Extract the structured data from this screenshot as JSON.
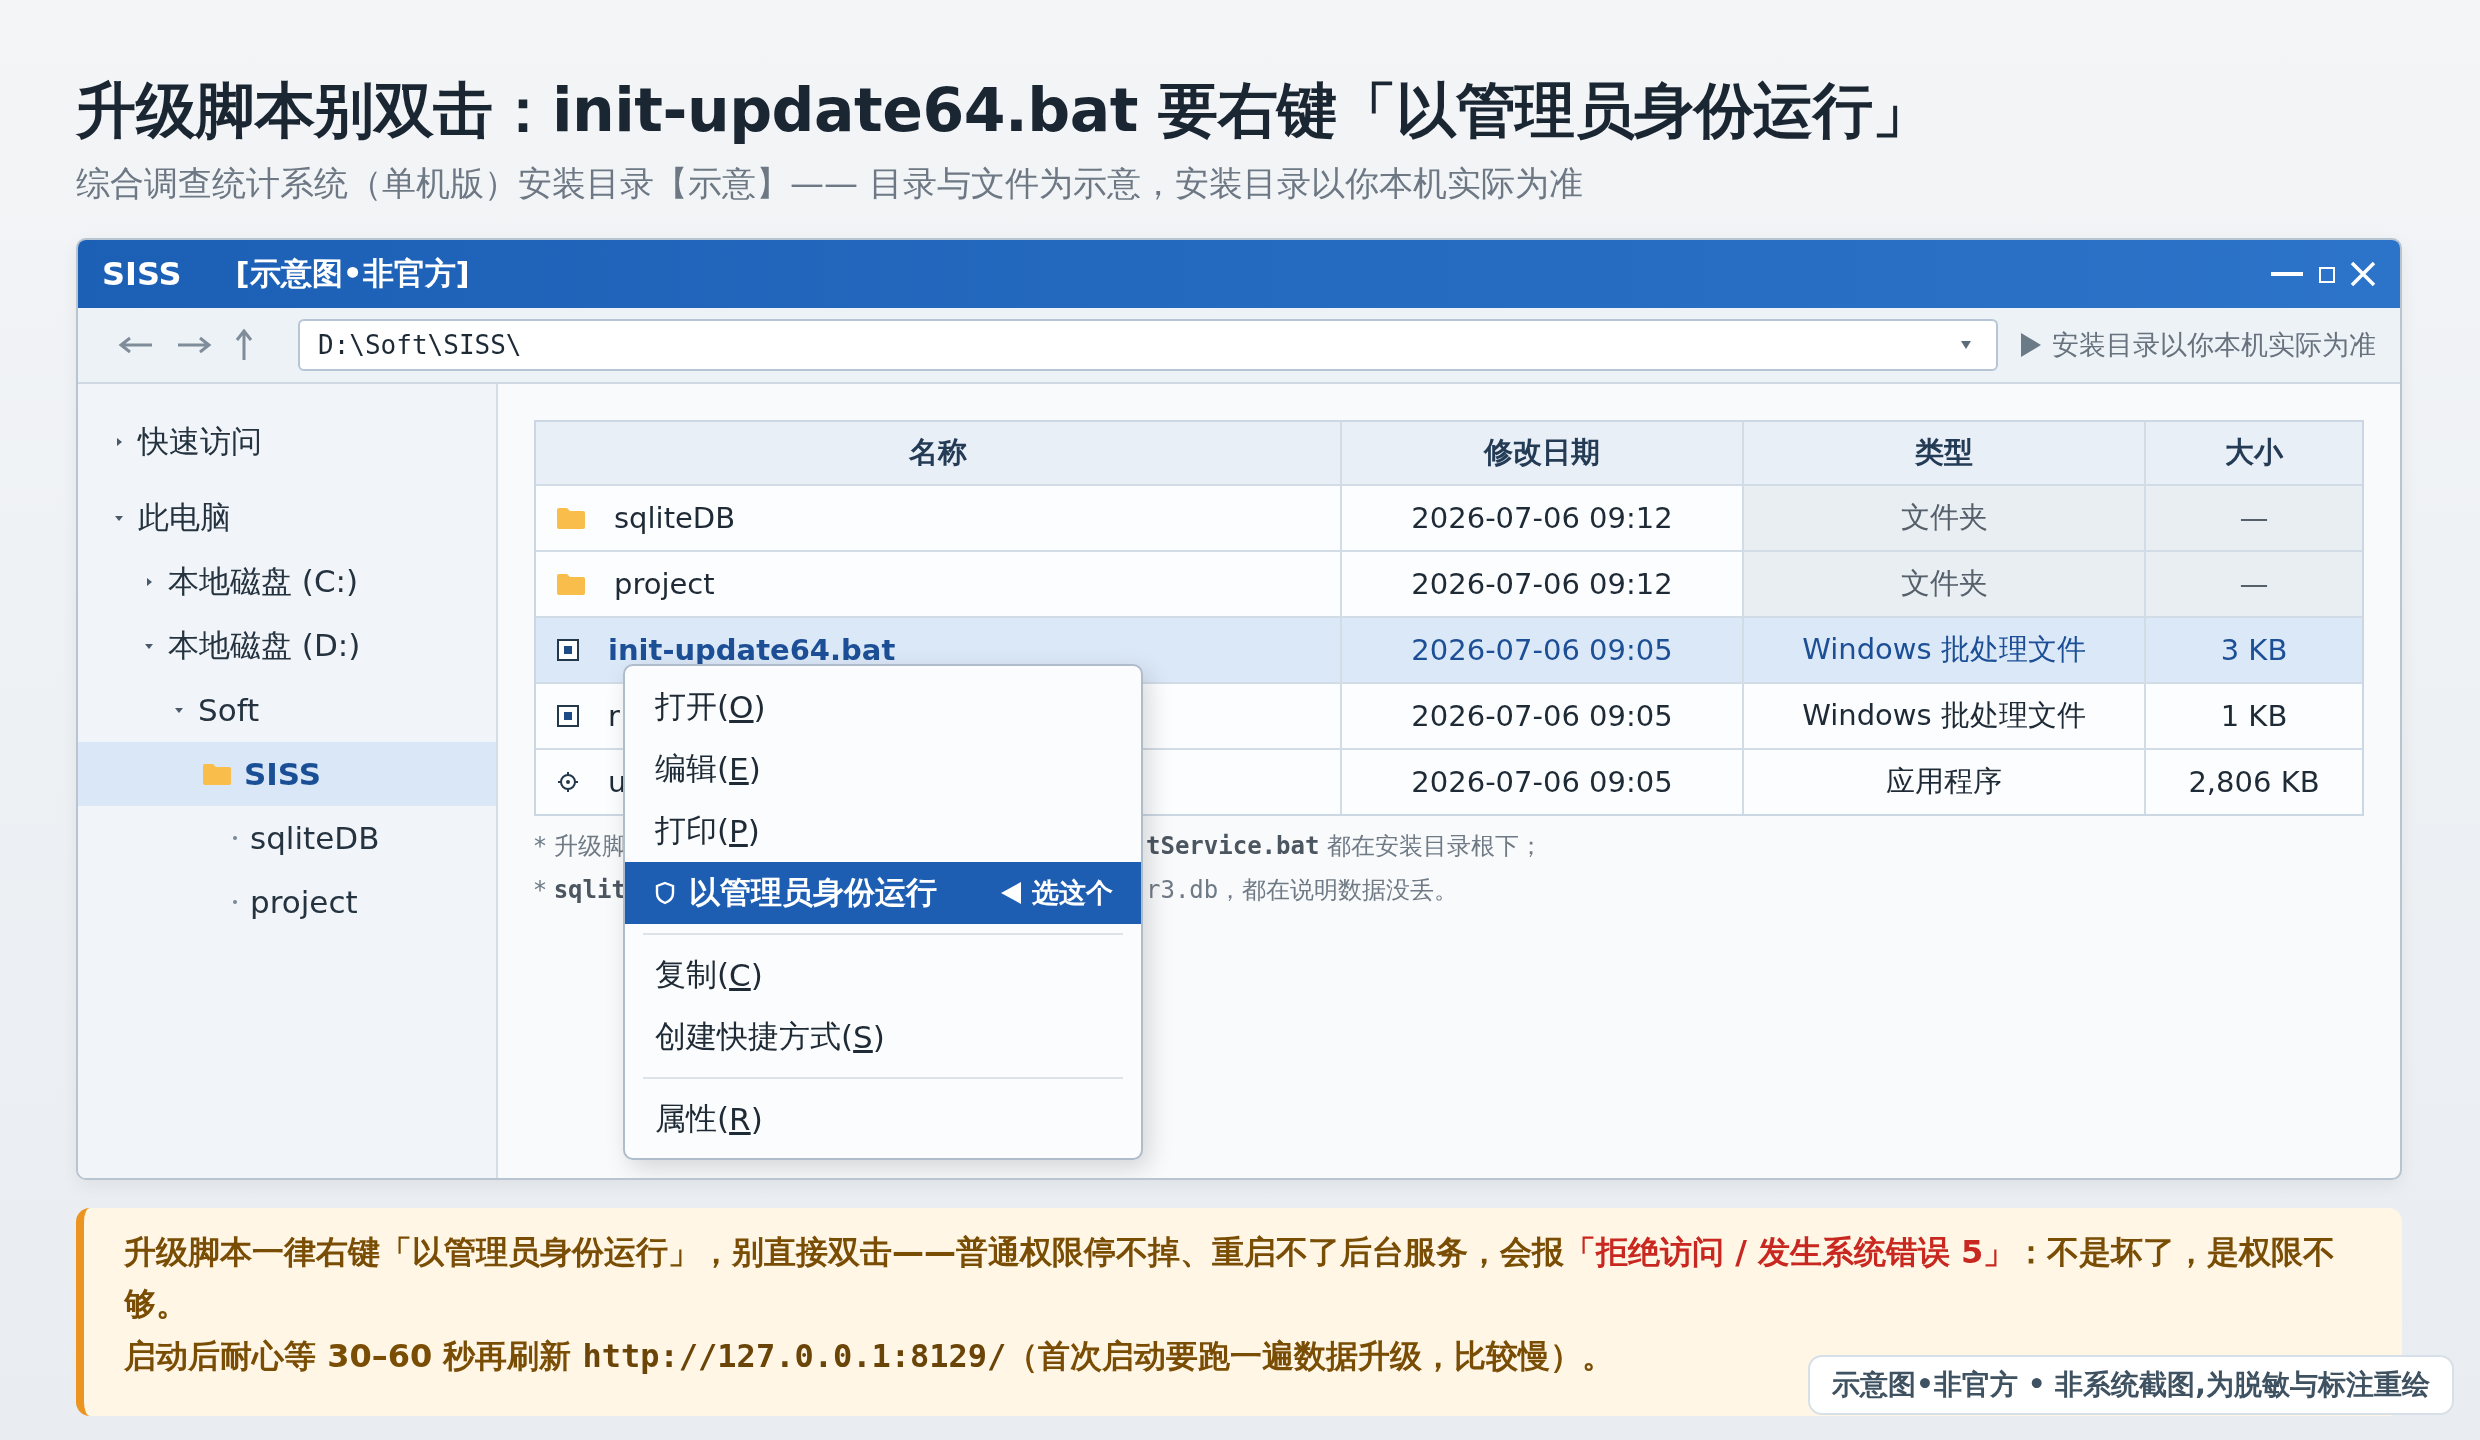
{
  "heading": {
    "title": "升级脚本别双击：init-update64.bat 要右键「以管理员身份运行」",
    "subtitle": "综合调查统计系统（单机版）安装目录【示意】—— 目录与文件为示意，安装目录以你本机实际为准"
  },
  "window": {
    "app": "SISS",
    "title": "[示意图•非官方]"
  },
  "toolbar": {
    "address": "D:\\Soft\\SISS\\",
    "hint": "安装目录以你本机实际为准"
  },
  "sidebar": {
    "items": [
      {
        "label": "快速访问",
        "kind": "node",
        "expanded": false,
        "selected": false
      },
      {
        "label": "此电脑",
        "kind": "node",
        "expanded": true,
        "selected": false,
        "children": [
          {
            "label": "本地磁盘 (C:)",
            "kind": "node",
            "expanded": false,
            "selected": false
          },
          {
            "label": "本地磁盘 (D:)",
            "kind": "node",
            "expanded": true,
            "selected": false,
            "children": [
              {
                "label": "Soft",
                "kind": "node",
                "expanded": true,
                "selected": false,
                "children": [
                  {
                    "label": "SISS",
                    "kind": "folder",
                    "selected": true,
                    "children": [
                      {
                        "label": "sqliteDB",
                        "kind": "leaf",
                        "selected": false
                      },
                      {
                        "label": "project",
                        "kind": "leaf",
                        "selected": false
                      }
                    ]
                  }
                ]
              }
            ]
          }
        ]
      }
    ]
  },
  "table": {
    "columns": [
      "名称",
      "修改日期",
      "类型",
      "大小"
    ],
    "rows": [
      {
        "kind": "folder",
        "name": "sqliteDB",
        "date": "2026-07-06 09:12",
        "type": "文件夹",
        "size": "—",
        "selected": false
      },
      {
        "kind": "folder",
        "name": "project",
        "date": "2026-07-06 09:12",
        "type": "文件夹",
        "size": "—",
        "selected": false
      },
      {
        "kind": "bat",
        "name": "init-update64.bat",
        "date": "2026-07-06 09:05",
        "type": "Windows 批处理文件",
        "size": "3 KB",
        "selected": true
      },
      {
        "kind": "bat",
        "name": "r",
        "date": "2026-07-06 09:05",
        "type": "Windows 批处理文件",
        "size": "1 KB",
        "selected": false
      },
      {
        "kind": "app",
        "name": "u",
        "date": "2026-07-06 09:05",
        "type": "应用程序",
        "size": "2,806 KB",
        "selected": false
      }
    ]
  },
  "notes": [
    {
      "left": [
        {
          "kind": "text",
          "text": "* 升级脚"
        }
      ],
      "right": [
        {
          "kind": "code",
          "text": "tService.bat"
        },
        {
          "kind": "text",
          "text": " 都在安装目录根下；"
        }
      ]
    },
    {
      "left": [
        {
          "kind": "text",
          "text": "* "
        },
        {
          "kind": "code",
          "text": "sqlit"
        }
      ],
      "right": [
        {
          "kind": "mono",
          "text": "r3.db"
        },
        {
          "kind": "text",
          "text": "，都在说明数据没丢。"
        }
      ]
    }
  ],
  "context_menu": {
    "items": [
      {
        "kind": "item",
        "before": "打开(",
        "key": "O",
        "after": ")",
        "selected": false
      },
      {
        "kind": "item",
        "before": "编辑(",
        "key": "E",
        "after": ")",
        "selected": false
      },
      {
        "kind": "item",
        "before": "打印(",
        "key": "P",
        "after": ")",
        "selected": false
      },
      {
        "kind": "admin",
        "label": "以管理员身份运行",
        "hint": "选这个",
        "selected": true
      },
      {
        "kind": "separator"
      },
      {
        "kind": "item",
        "before": "复制(",
        "key": "C",
        "after": ")",
        "selected": false
      },
      {
        "kind": "item",
        "before": "创建快捷方式(",
        "key": "S",
        "after": ")",
        "selected": false
      },
      {
        "kind": "separator"
      },
      {
        "kind": "item",
        "before": "属性(",
        "key": "R",
        "after": ")",
        "selected": false
      }
    ]
  },
  "callout": {
    "lines": [
      [
        {
          "kind": "text",
          "text": "升级脚本一律右键「以管理员身份运行」，别直接双击——普通权限停不掉、重启不了后台服务，会报"
        },
        {
          "kind": "alert",
          "text": "「拒绝访问 / 发生系统错误 5」"
        },
        {
          "kind": "text",
          "text": "：不是坏了，是权限不够。"
        }
      ],
      [
        {
          "kind": "text",
          "text": "启动后耐心等 30–60 秒再刷新 "
        },
        {
          "kind": "code",
          "text": "http://127.0.0.1:8129/"
        },
        {
          "kind": "text",
          "text": "（首次启动要跑一遍数据升级，比较慢）。"
        }
      ]
    ]
  },
  "badge": "示意图•非官方 • 非系统截图,为脱敏与标注重绘"
}
